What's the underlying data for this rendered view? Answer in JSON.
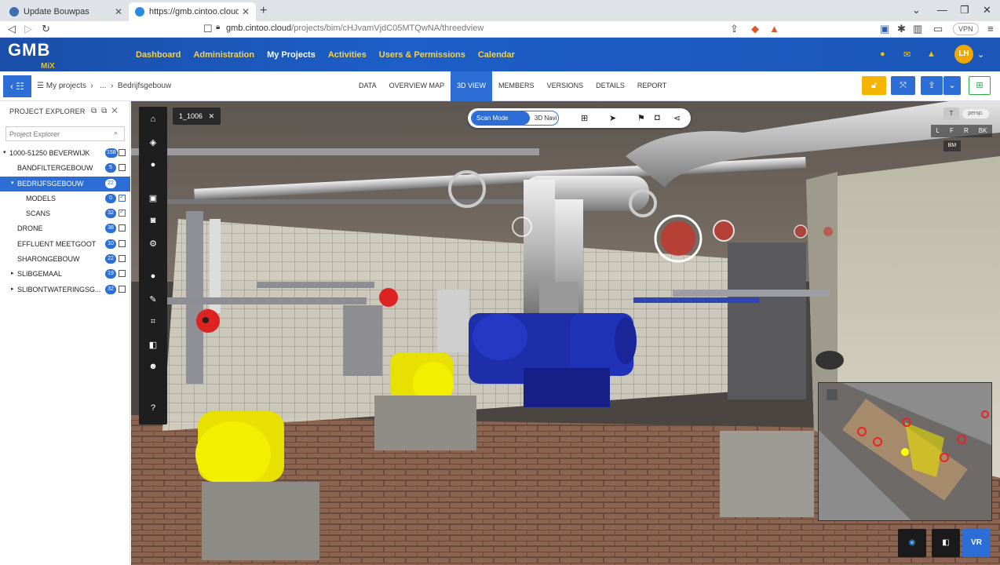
{
  "browser": {
    "tabs": [
      {
        "title": "Update Bouwpas",
        "active": false
      },
      {
        "title": "https://gmb.cintoo.cloud/projects",
        "active": true
      }
    ],
    "url_host": "gmb.cintoo.cloud",
    "url_path": "/projects/bim/cHJvamVjdC05MTQwNA/threedview",
    "vpn_label": "VPN"
  },
  "app": {
    "logo": "GMB",
    "logo_sub": "MiX",
    "nav": [
      "Dashboard",
      "Administration",
      "My Projects",
      "Activities",
      "Users & Permissions",
      "Calendar"
    ],
    "current_nav": "My Projects",
    "user_initials": "LH"
  },
  "subheader": {
    "breadcrumb": [
      "My projects",
      "...",
      "Bedrijfsgebouw"
    ],
    "tabs": [
      "DATA",
      "OVERVIEW MAP",
      "3D VIEW",
      "MEMBERS",
      "VERSIONS",
      "DETAILS",
      "REPORT"
    ],
    "current_tab": "3D VIEW"
  },
  "sidebar": {
    "title": "PROJECT EXPLORER",
    "search_placeholder": "Project Explorer",
    "items": [
      {
        "label": "1000-51250 BEVERWIJK",
        "count": "158",
        "indent": 0,
        "arrow": "▾",
        "checkbox": true,
        "checked": false,
        "selected": false
      },
      {
        "label": "BANDFILTERGEBOUW",
        "count": "5",
        "indent": 1,
        "arrow": "",
        "checkbox": true,
        "checked": false,
        "selected": false
      },
      {
        "label": "BEDRIJFSGEBOUW",
        "count": "22",
        "indent": 1,
        "arrow": "▾",
        "checkbox": false,
        "checked": false,
        "selected": true
      },
      {
        "label": "MODELS",
        "count": "0",
        "indent": 2,
        "arrow": "",
        "checkbox": true,
        "checked": true,
        "selected": false
      },
      {
        "label": "SCANS",
        "count": "32",
        "indent": 2,
        "arrow": "",
        "checkbox": true,
        "checked": true,
        "selected": false
      },
      {
        "label": "DRONE",
        "count": "38",
        "indent": 1,
        "arrow": "",
        "checkbox": true,
        "checked": false,
        "selected": false
      },
      {
        "label": "EFFLUENT MEETGOOT",
        "count": "10",
        "indent": 1,
        "arrow": "",
        "checkbox": true,
        "checked": false,
        "selected": false
      },
      {
        "label": "SHARONGEBOUW",
        "count": "22",
        "indent": 1,
        "arrow": "",
        "checkbox": true,
        "checked": false,
        "selected": false
      },
      {
        "label": "SLIBGEMAAL",
        "count": "19",
        "indent": 1,
        "arrow": "▸",
        "checkbox": true,
        "checked": false,
        "selected": false
      },
      {
        "label": "SLIBONTWATERINGSG...",
        "count": "32",
        "indent": 1,
        "arrow": "▸",
        "checkbox": true,
        "checked": false,
        "selected": false
      }
    ]
  },
  "viewer": {
    "scan_chip": "1_1006",
    "mode_on": "Scan Mode",
    "mode_off": "3D Navi",
    "viewcube": {
      "top": "T",
      "persp": "persp.",
      "faces": [
        "L",
        "F",
        "R",
        "BK"
      ],
      "bottom": "BM"
    },
    "vr_label": "VR"
  },
  "colors": {
    "primary": "#2c6ed5",
    "header_blue": "#1d5fc7",
    "nav_yellow": "#f6d24a",
    "lock_btn": "#f4b400",
    "add_btn": "#27a844"
  }
}
